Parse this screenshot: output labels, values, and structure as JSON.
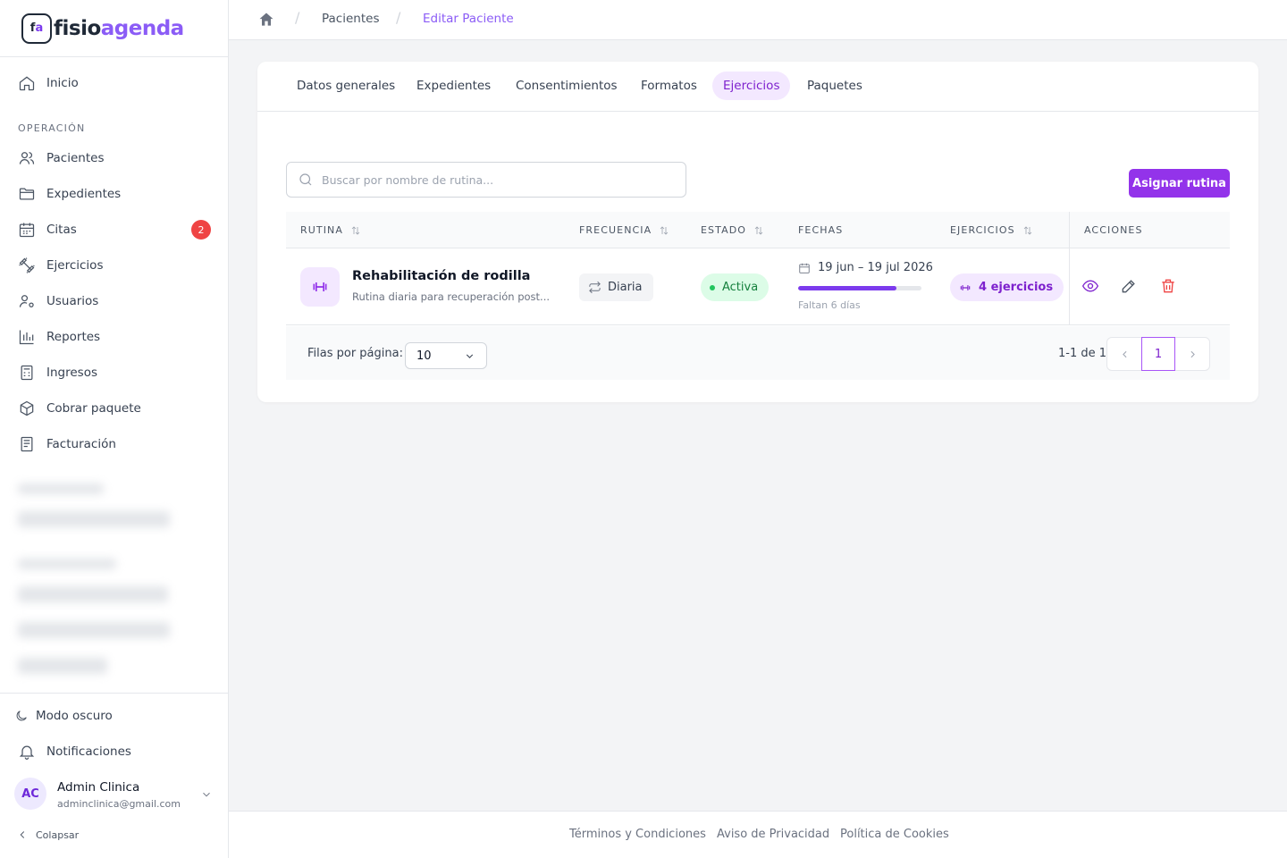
{
  "app": {
    "logo_mark_f": "f",
    "logo_mark_a": "a",
    "logo_text_1": "fisio",
    "logo_text_2": "agenda"
  },
  "sidebar": {
    "home": "Inicio",
    "section_operation": "OPERACIÓN",
    "items": [
      {
        "label": "Pacientes"
      },
      {
        "label": "Expedientes"
      },
      {
        "label": "Citas",
        "badge": "2"
      },
      {
        "label": "Ejercicios"
      },
      {
        "label": "Usuarios"
      },
      {
        "label": "Reportes"
      },
      {
        "label": "Ingresos"
      },
      {
        "label": "Cobrar paquete"
      },
      {
        "label": "Facturación"
      }
    ],
    "dark_mode": "Modo oscuro",
    "notifications": "Notificaciones",
    "user": {
      "initials": "AC",
      "name": "Admin Clinica",
      "email": "adminclinica@gmail.com"
    },
    "collapse": "Colapsar"
  },
  "breadcrumb": {
    "items": [
      "Pacientes",
      "Editar Paciente"
    ]
  },
  "tabs": [
    "Datos generales",
    "Expedientes",
    "Consentimientos",
    "Formatos",
    "Ejercicios",
    "Paquetes"
  ],
  "active_tab": "Ejercicios",
  "search": {
    "placeholder": "Buscar por nombre de rutina..."
  },
  "assign_button": "Asignar rutina",
  "table": {
    "headers": {
      "routine": "RUTINA",
      "frequency": "FRECUENCIA",
      "status": "ESTADO",
      "dates": "FECHAS",
      "exercises": "EJERCICIOS",
      "actions": "ACCIONES"
    },
    "rows": [
      {
        "title": "Rehabilitación de rodilla",
        "description": "Rutina diaria para recuperación post...",
        "frequency": "Diaria",
        "status": "Activa",
        "dates": "19 jun – 19 jul 2026",
        "progress_percent": 80,
        "remaining": "Faltan 6 días",
        "exercises": "4 ejercicios"
      }
    ],
    "rows_per_page_label": "Filas por página:",
    "rows_per_page": "10",
    "range": "1-1 de 1",
    "current_page": "1"
  },
  "footer": {
    "links": [
      "Términos y Condiciones",
      "Aviso de Privacidad",
      "Política de Cookies"
    ]
  },
  "colors": {
    "accent": "#9333ea",
    "active_tab_bg": "#f3e8ff",
    "status_active": "#15803d",
    "badge": "#ef4444"
  }
}
